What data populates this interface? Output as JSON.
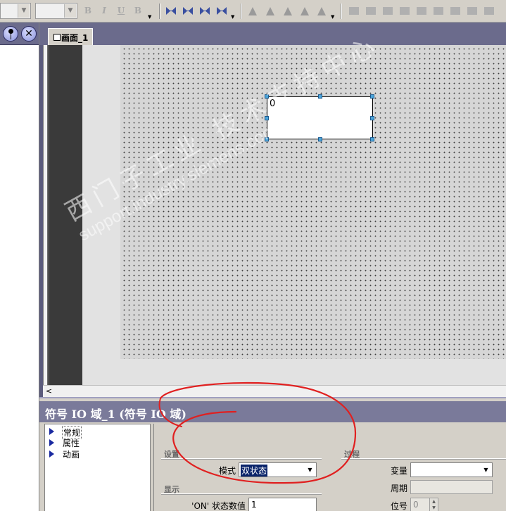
{
  "window": {
    "tab_title": "画面_1"
  },
  "canvas": {
    "io_field_value": "0",
    "watermark_chinese": "西门子工业 技术支持中心",
    "watermark_url": "support.industry.siemens.com/cs"
  },
  "properties": {
    "title": "符号 IO 域_1 (符号 IO 域)",
    "tree_items": [
      {
        "label": "常规"
      },
      {
        "label": "属性"
      },
      {
        "label": "动画"
      }
    ],
    "settings_group": "设置",
    "mode_label": "模式",
    "mode_value": "双状态",
    "display_group": "显示",
    "on_state_label": "'ON' 状态数值",
    "on_state_value": "1",
    "process_group": "过程",
    "variable_label": "变量",
    "variable_value": "",
    "period_label": "周期",
    "period_value": "",
    "bit_label": "位号",
    "bit_value": "0"
  },
  "colors": {
    "annotation": "#e02020",
    "title_bar": "#7a7a9a",
    "selection": "#0a246a",
    "handle": "#4aa3d8"
  },
  "icons": {
    "bold": "B",
    "italic": "I",
    "underline": "U",
    "font_style": "B"
  }
}
